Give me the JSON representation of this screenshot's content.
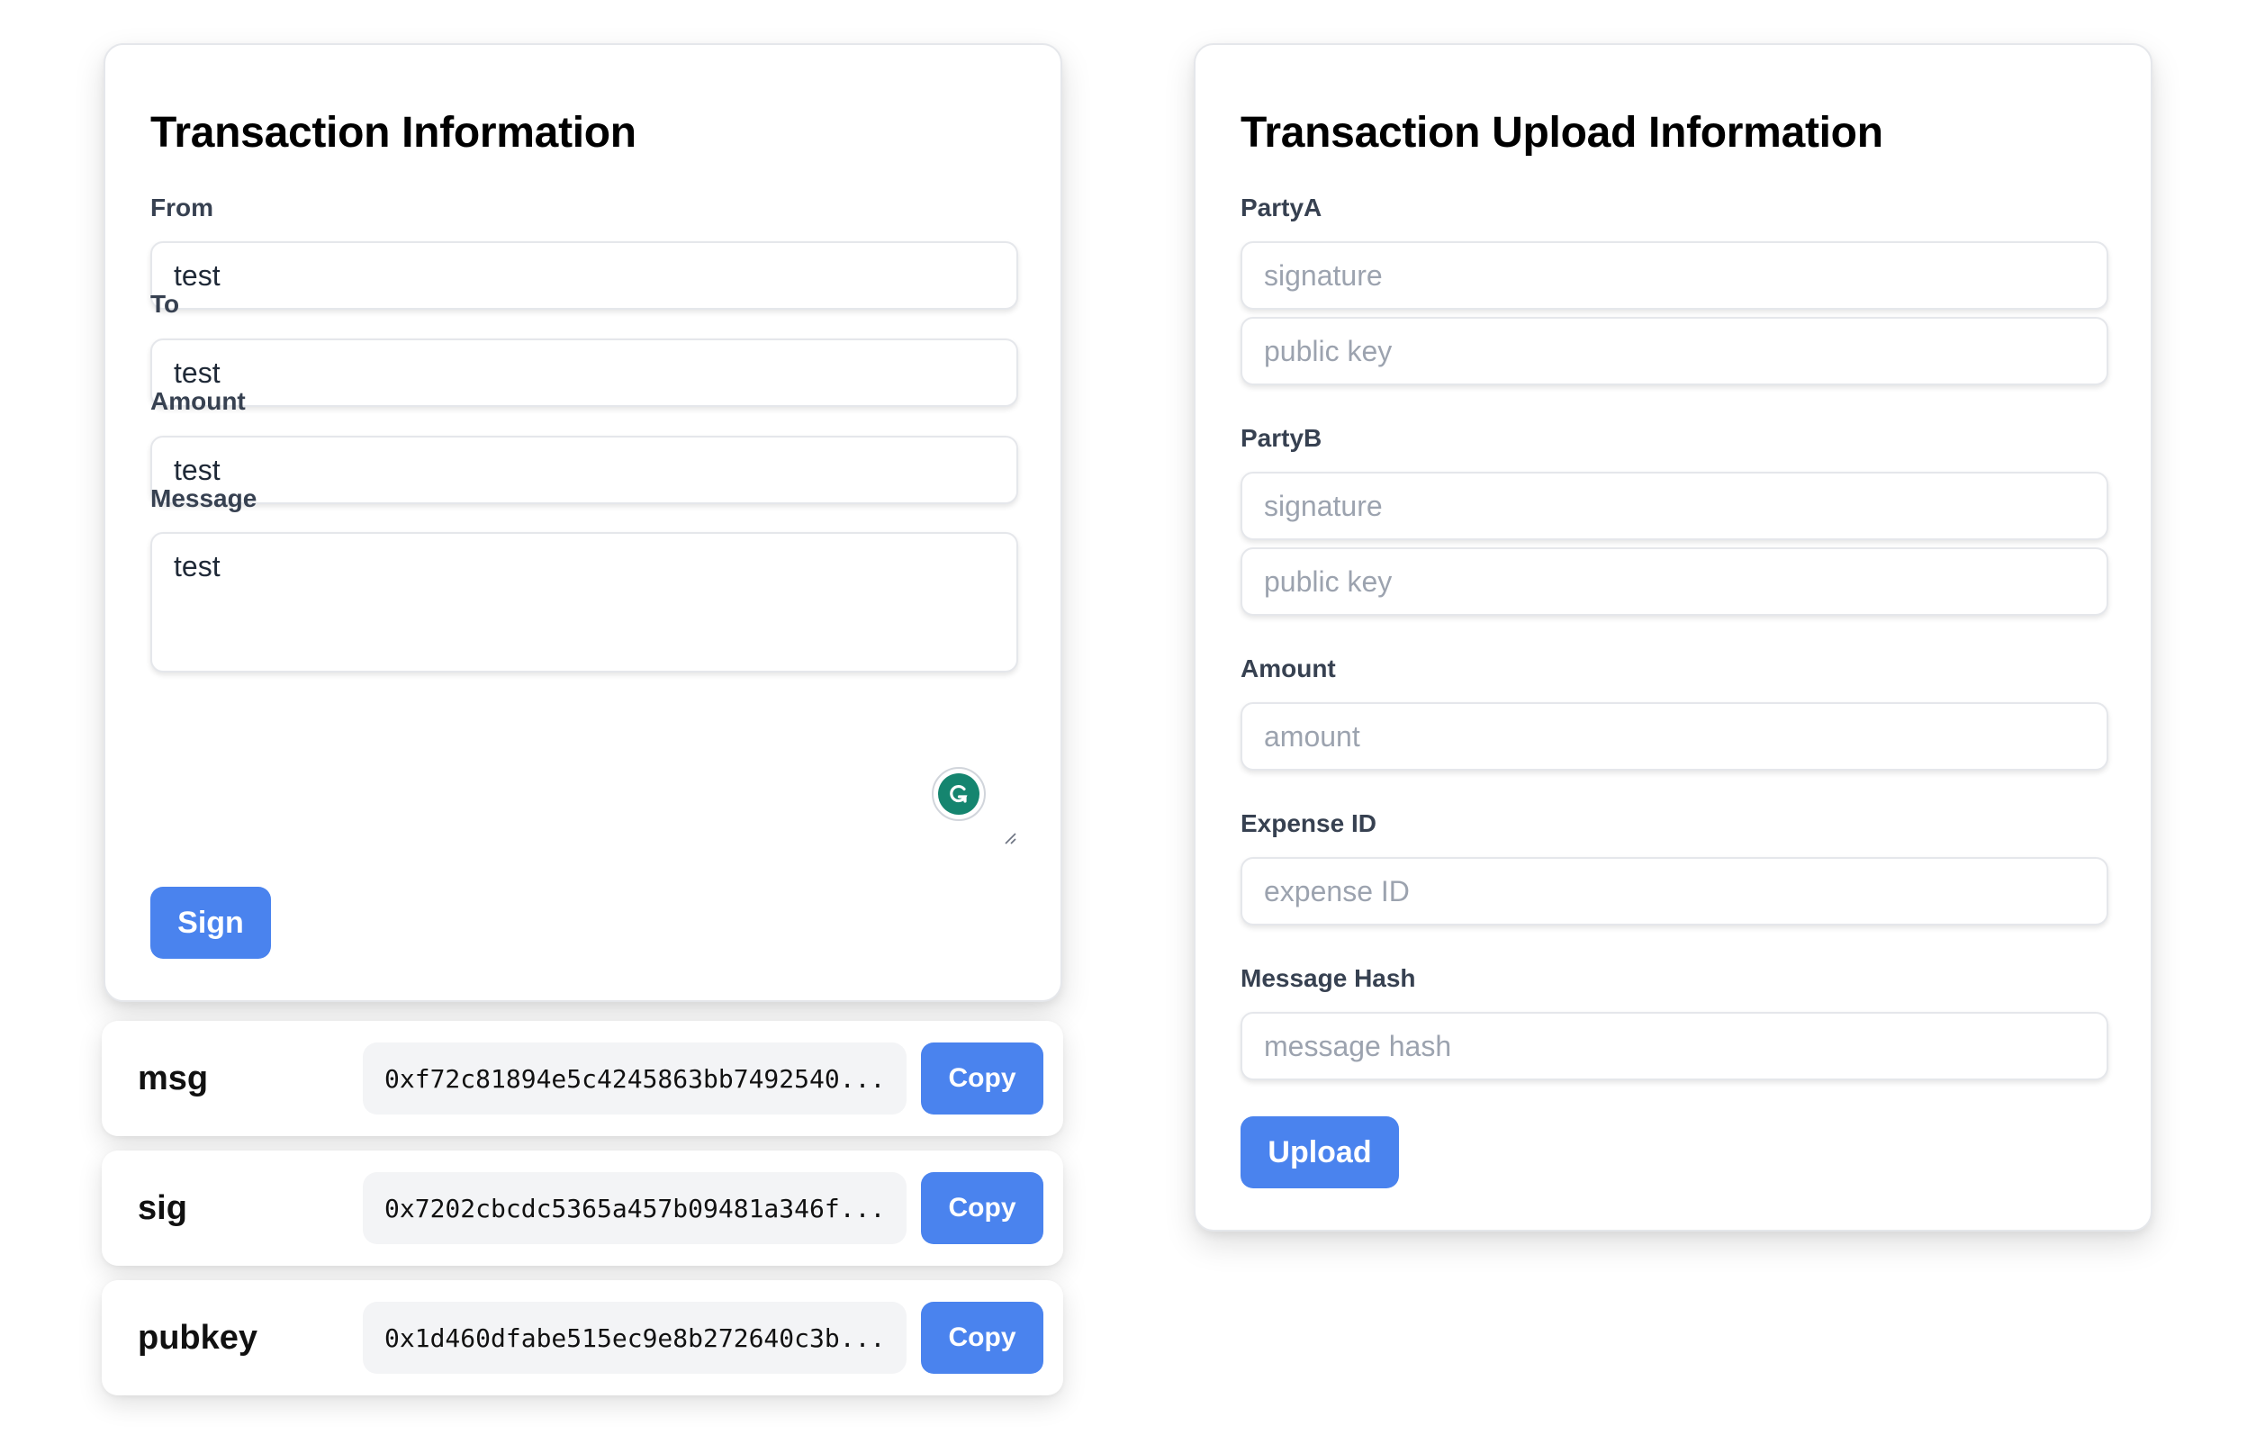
{
  "left_card": {
    "title": "Transaction Information",
    "from": {
      "label": "From",
      "value": "test"
    },
    "to": {
      "label": "To",
      "value": "test"
    },
    "amount": {
      "label": "Amount",
      "value": "test"
    },
    "message": {
      "label": "Message",
      "value": "test"
    },
    "sign_button": "Sign"
  },
  "outputs": [
    {
      "label": "msg",
      "value": "0xf72c81894e5c4245863bb7492540...",
      "copy_label": "Copy"
    },
    {
      "label": "sig",
      "value": "0x7202cbcdc5365a457b09481a346f...",
      "copy_label": "Copy"
    },
    {
      "label": "pubkey",
      "value": "0x1d460dfabe515ec9e8b272640c3b...",
      "copy_label": "Copy"
    }
  ],
  "right_card": {
    "title": "Transaction Upload Information",
    "party_a": {
      "label": "PartyA",
      "signature_placeholder": "signature",
      "public_key_placeholder": "public key"
    },
    "party_b": {
      "label": "PartyB",
      "signature_placeholder": "signature",
      "public_key_placeholder": "public key"
    },
    "amount": {
      "label": "Amount",
      "placeholder": "amount"
    },
    "expense_id": {
      "label": "Expense ID",
      "placeholder": "expense ID"
    },
    "message_hash": {
      "label": "Message Hash",
      "placeholder": "message hash"
    },
    "upload_button": "Upload"
  },
  "icons": {
    "grammarly": "grammarly-icon",
    "resize": "resize-grip-icon"
  },
  "colors": {
    "primary_button": "#4a83ee",
    "grammarly": "#15856f",
    "label": "#374151",
    "placeholder": "#9ca3af",
    "mono_bg": "#f3f4f6"
  }
}
